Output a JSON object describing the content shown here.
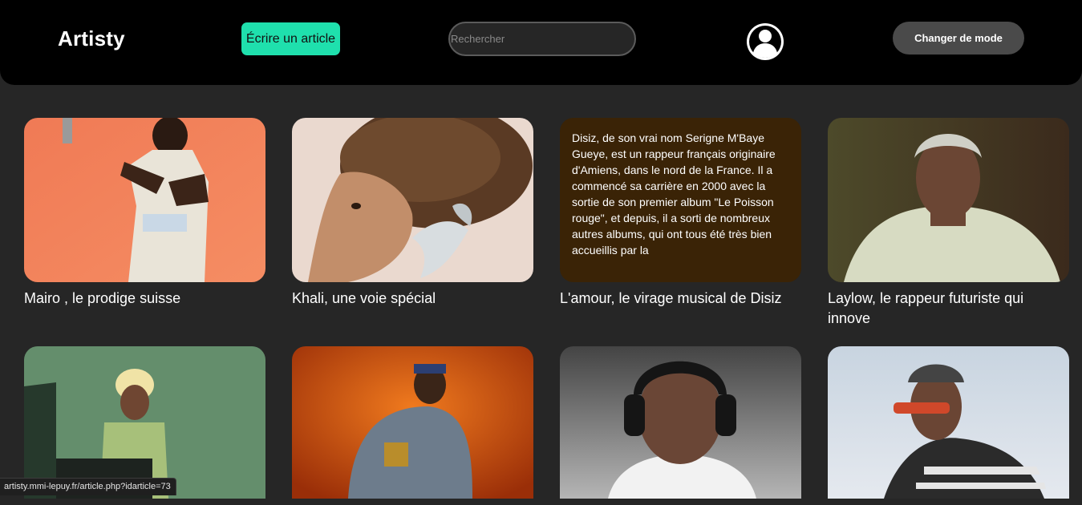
{
  "header": {
    "logo": "Artisty",
    "write_button": "Écrire un article",
    "search_placeholder": "Rechercher",
    "mode_button": "Changer de mode"
  },
  "articles": [
    {
      "title": "Mairo , le prodige suisse"
    },
    {
      "title": "Khali, une voie spécial"
    },
    {
      "title": "L'amour, le virage musical de Disiz",
      "hover_text": "Disiz, de son vrai nom Serigne M'Baye Gueye, est un rappeur français originaire d'Amiens, dans le nord de la France. Il a commencé sa carrière en 2000 avec la sortie de son premier album \"Le Poisson rouge\", et depuis, il a sorti de nombreux autres albums, qui ont tous été très bien accueillis par la"
    },
    {
      "title": "Laylow, le rappeur futuriste qui innove"
    },
    {
      "title": ""
    },
    {
      "title": ""
    },
    {
      "title": ""
    },
    {
      "title": ""
    }
  ],
  "status_url": "artisty.mmi-lepuy.fr/article.php?idarticle=73",
  "colors": {
    "accent": "#1fe0ad",
    "header_bg": "#000000",
    "page_bg": "#262626",
    "hover_card_bg": "#3a2306"
  }
}
